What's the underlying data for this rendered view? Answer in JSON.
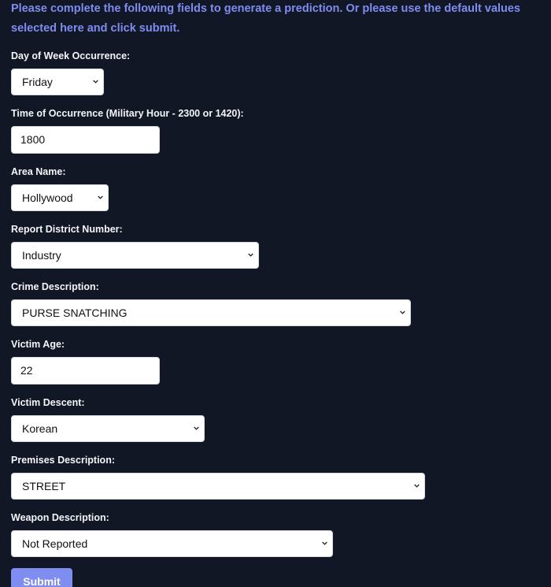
{
  "intro": "Please complete the following fields to generate a prediction. Or please use the default values selected here and click submit.",
  "fields": {
    "day_of_week": {
      "label": "Day of Week Occurrence:",
      "value": "Friday"
    },
    "time": {
      "label": "Time of Occurrence (Military Hour - 2300 or 1420):",
      "value": "1800"
    },
    "area": {
      "label": "Area Name:",
      "value": "Hollywood"
    },
    "report_district": {
      "label": "Report District Number:",
      "value": "Industry"
    },
    "crime": {
      "label": "Crime Description:",
      "value": "PURSE SNATCHING"
    },
    "victim_age": {
      "label": "Victim Age:",
      "value": "22"
    },
    "victim_descent": {
      "label": "Victim Descent:",
      "value": "Korean"
    },
    "premises": {
      "label": "Premises Description:",
      "value": "STREET"
    },
    "weapon": {
      "label": "Weapon Description:",
      "value": "Not Reported"
    }
  },
  "submit_label": "Submit",
  "colors": {
    "background": "#121725",
    "accent": "#7f8cf0",
    "label_text": "#f4f5f8",
    "control_background": "#ffffff"
  },
  "icons": {
    "select_indicator": "chevron-down-icon"
  }
}
